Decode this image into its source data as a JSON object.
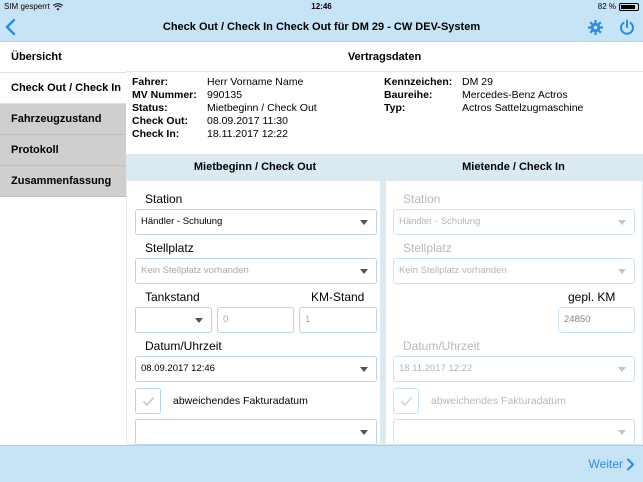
{
  "statusbar": {
    "carrier": "SIM gesperrt",
    "time": "12:46",
    "battery": "82 %",
    "battery_level": 0.82
  },
  "navbar": {
    "title": "Check Out / Check In Check Out für DM 29 - CW DEV-System"
  },
  "sidebar": {
    "items": [
      {
        "label": "Übersicht"
      },
      {
        "label": "Check Out / Check In"
      },
      {
        "label": "Fahrzeugzustand"
      },
      {
        "label": "Protokoll"
      },
      {
        "label": "Zusammenfassung"
      }
    ]
  },
  "vertragsdaten": {
    "title": "Vertragsdaten",
    "left": [
      {
        "label": "Fahrer:",
        "value": "Herr Vorname Name"
      },
      {
        "label": "MV Nummer:",
        "value": "990135"
      },
      {
        "label": "Status:",
        "value": "Mietbeginn / Check Out"
      },
      {
        "label": "Check Out:",
        "value": "08.09.2017 11:30"
      },
      {
        "label": "Check In:",
        "value": "18.11.2017 12:22"
      }
    ],
    "right": [
      {
        "label": "Kennzeichen:",
        "value": "DM 29"
      },
      {
        "label": "Baureihe:",
        "value": "Mercedes-Benz Actros"
      },
      {
        "label": "Typ:",
        "value": "Actros Sattelzugmaschine"
      }
    ]
  },
  "checkout": {
    "header": "Mietbeginn / Check Out",
    "station_label": "Station",
    "station_value": "Händler - Schulung",
    "stellplatz_label": "Stellplatz",
    "stellplatz_placeholder": "Kein Stellplatz vorhanden",
    "tankstand_label": "Tankstand",
    "tankstand_value": "",
    "tank_number": "0",
    "km_label": "KM-Stand",
    "km_value": "1",
    "datum_label": "Datum/Uhrzeit",
    "datum_value": "08.09.2017 12:46",
    "faktura_label": "abweichendes Fakturadatum",
    "faktura_value": ""
  },
  "checkin": {
    "header": "Mietende / Check In",
    "station_label": "Station",
    "station_value": "Händler - Schulung",
    "stellplatz_label": "Stellplatz",
    "stellplatz_placeholder": "Kein Stellplatz vorhanden",
    "km_label": "gepl. KM",
    "km_value": "24850",
    "datum_label": "Datum/Uhrzeit",
    "datum_value": "18.11.2017 12:22",
    "faktura_label": "abweichendes Fakturadatum",
    "faktura_value": ""
  },
  "footer": {
    "next_label": "Weiter"
  },
  "colors": {
    "bar": "#c7e3f6",
    "accent": "#2a8be0",
    "field_border": "#b5d4e8",
    "sidebar_inactive": "#cfcfcf"
  }
}
